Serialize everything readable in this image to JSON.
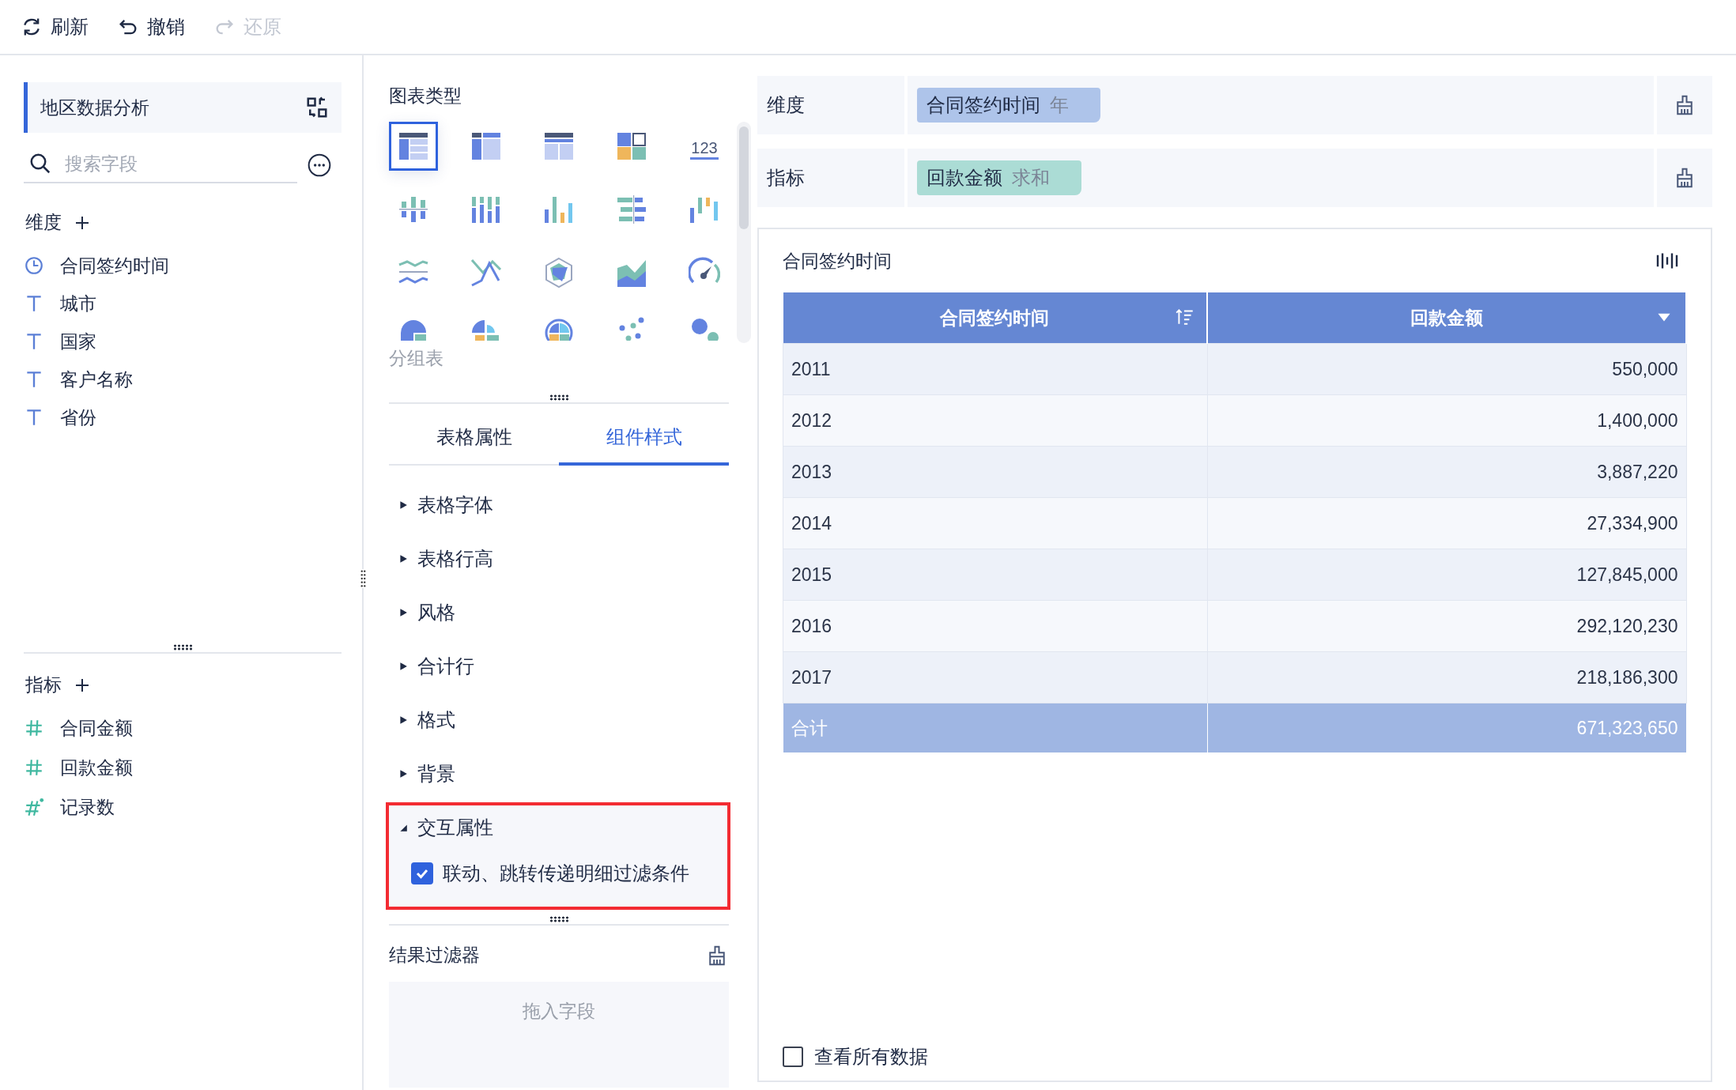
{
  "toolbar": [
    {
      "label": "刷新",
      "kind": "refresh",
      "disabled": false
    },
    {
      "label": "撤销",
      "kind": "undo",
      "disabled": false
    },
    {
      "label": "还原",
      "kind": "redo",
      "disabled": true
    }
  ],
  "sidebar": {
    "title": "地区数据分析",
    "search": {
      "placeholder": "搜索字段"
    },
    "dimensions": {
      "label": "维度",
      "fields": [
        {
          "name": "合同签约时间",
          "kind": "date"
        },
        {
          "name": "城市",
          "kind": "text"
        },
        {
          "name": "国家",
          "kind": "text"
        },
        {
          "name": "客户名称",
          "kind": "text"
        },
        {
          "name": "省份",
          "kind": "text"
        }
      ]
    },
    "measures": {
      "label": "指标",
      "fields": [
        {
          "name": "合同金额",
          "kind": "number"
        },
        {
          "name": "回款金额",
          "kind": "number"
        },
        {
          "name": "记录数",
          "kind": "count"
        }
      ]
    }
  },
  "chart_types": {
    "title": "图表类型",
    "hover_label": "分组表",
    "items": [
      {
        "kind": "group-table",
        "selected": true
      },
      {
        "kind": "cross-table",
        "selected": false
      },
      {
        "kind": "detail-table",
        "selected": false
      },
      {
        "kind": "kpi-grid",
        "selected": false
      },
      {
        "kind": "number",
        "glyph": "123",
        "selected": false
      },
      {
        "kind": "diverging-column",
        "selected": false
      },
      {
        "kind": "stacked-column",
        "selected": false
      },
      {
        "kind": "column",
        "selected": false
      },
      {
        "kind": "diverging-bar",
        "selected": false
      },
      {
        "kind": "floating-column",
        "selected": false
      },
      {
        "kind": "wave-lines",
        "selected": false
      },
      {
        "kind": "line",
        "selected": false
      },
      {
        "kind": "radar",
        "selected": false
      },
      {
        "kind": "area",
        "selected": false
      },
      {
        "kind": "gauge",
        "selected": false
      },
      {
        "kind": "pie",
        "selected": false
      },
      {
        "kind": "rose",
        "selected": false
      },
      {
        "kind": "sunburst",
        "selected": false
      },
      {
        "kind": "scatter",
        "selected": false
      },
      {
        "kind": "bubble",
        "selected": false
      }
    ]
  },
  "property_tabs": [
    {
      "label": "表格属性",
      "selected": false
    },
    {
      "label": "组件样式",
      "selected": true
    }
  ],
  "style_sections": [
    {
      "label": "表格字体",
      "expanded": false,
      "highlighted": false
    },
    {
      "label": "表格行高",
      "expanded": false,
      "highlighted": false
    },
    {
      "label": "风格",
      "expanded": false,
      "highlighted": false
    },
    {
      "label": "合计行",
      "expanded": false,
      "highlighted": false
    },
    {
      "label": "格式",
      "expanded": false,
      "highlighted": false
    },
    {
      "label": "背景",
      "expanded": false,
      "highlighted": false
    },
    {
      "label": "交互属性",
      "expanded": true,
      "highlighted": true,
      "options": [
        {
          "label": "联动、跳转传递明细过滤条件",
          "checked": true
        }
      ]
    }
  ],
  "result_filter": {
    "title": "结果过滤器",
    "placeholder": "拖入字段"
  },
  "shelves": [
    {
      "label": "维度",
      "pill": {
        "name": "合同签约时间",
        "suffix": "年",
        "kind": "dimension"
      }
    },
    {
      "label": "指标",
      "pill": {
        "name": "回款金额",
        "suffix": "求和",
        "kind": "measure"
      }
    }
  ],
  "widget": {
    "title": "合同签约时间",
    "table": {
      "columns": [
        {
          "label": "合同签约时间",
          "kind": "sort"
        },
        {
          "label": "回款金额",
          "kind": "dropdown"
        }
      ],
      "rows": [
        [
          "2011",
          "550,000"
        ],
        [
          "2012",
          "1,400,000"
        ],
        [
          "2013",
          "3,887,220"
        ],
        [
          "2014",
          "27,334,900"
        ],
        [
          "2015",
          "127,845,000"
        ],
        [
          "2016",
          "292,120,230"
        ],
        [
          "2017",
          "218,186,300"
        ]
      ],
      "total": [
        "合计",
        "671,323,650"
      ]
    },
    "show_all": {
      "label": "查看所有数据",
      "checked": false
    }
  }
}
